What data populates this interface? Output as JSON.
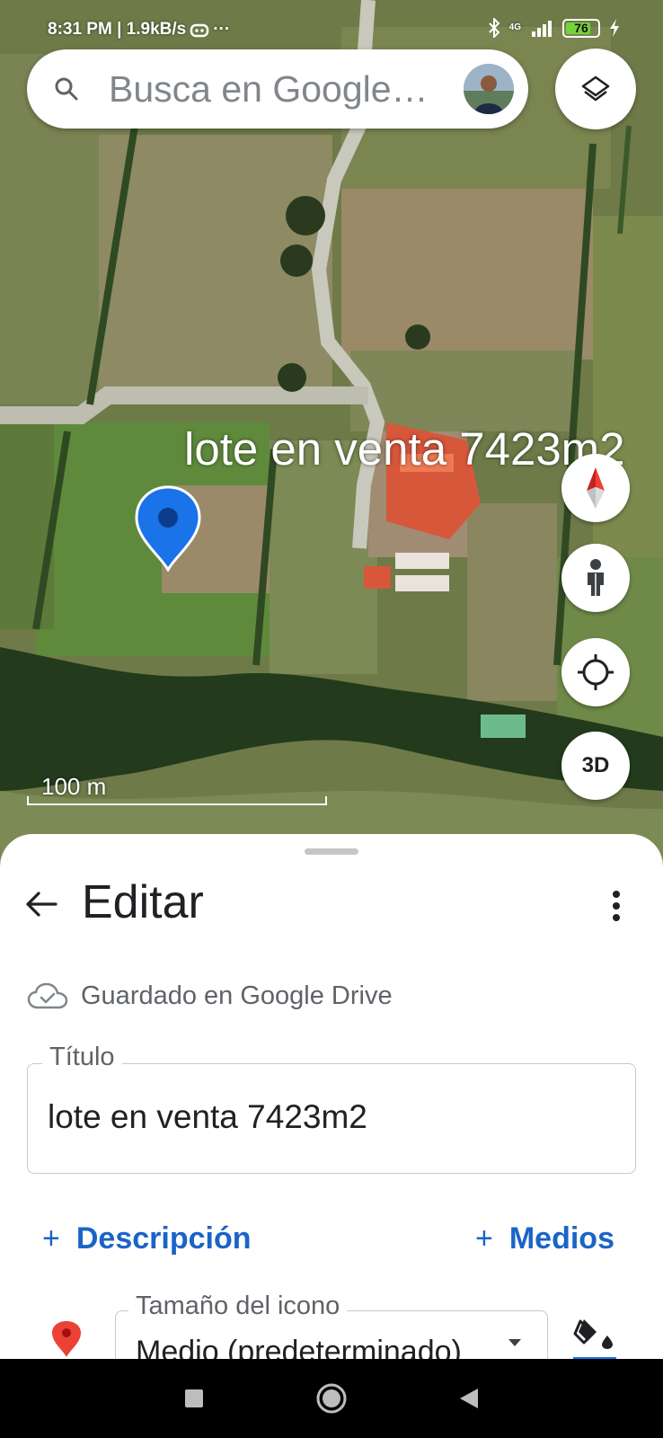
{
  "status_bar": {
    "time_speed": "8:31 PM | 1.9kB/s",
    "extra": "···",
    "network": "4G",
    "battery": "76"
  },
  "search": {
    "placeholder": "Busca en Google ..."
  },
  "map": {
    "marker_label": "lote en venta 7423m2",
    "scale_label": "100 m",
    "threed_label": "3D",
    "marker_color": "#1a73e8"
  },
  "sheet": {
    "title": "Editar",
    "saved_status": "Guardado en Google Drive",
    "title_field": {
      "label": "Título",
      "value": "lote en venta 7423m2"
    },
    "add_description": "Descripción",
    "add_media": "Medios",
    "plus": "+",
    "icon_size": {
      "label": "Tamaño del icono",
      "value": "Medio (predeterminado)"
    },
    "accent_color": "#1a64c8",
    "pin_color": "#ea4335"
  }
}
